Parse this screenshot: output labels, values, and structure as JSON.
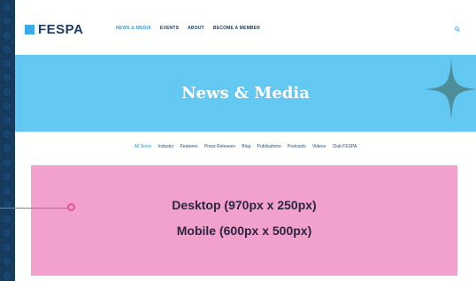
{
  "logo": {
    "text": "FESPA"
  },
  "nav": {
    "items": [
      "NEWS & MEDIA",
      "EVENTS",
      "ABOUT",
      "BECOME A MEMBER"
    ],
    "active": 0
  },
  "hero": {
    "title": "News & Media"
  },
  "subnav": {
    "items": [
      "All News",
      "Industry",
      "Features",
      "Press Releases",
      "Blog",
      "Publications",
      "Podcasts",
      "Videos",
      "Club FESPA"
    ],
    "active": 0
  },
  "banner": {
    "line1": "Desktop (970px x 250px)",
    "line2": "Mobile (600px x 500px)"
  },
  "colors": {
    "background": "#163a5e",
    "hero": "#63c8f2",
    "banner": "#f1a1cb",
    "accent_pink": "#e8509a",
    "accent_yellow": "#f6ee43"
  }
}
